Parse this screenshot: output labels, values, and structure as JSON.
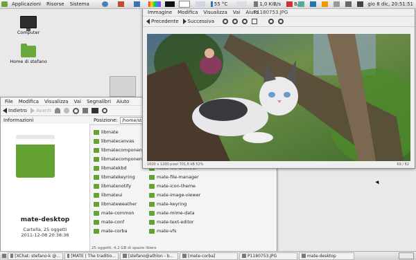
{
  "top_panel": {
    "menus": [
      "Applicazioni",
      "Risorse",
      "Sistema"
    ],
    "weather": "55 °C",
    "net_speed": "1,0 KiB/s",
    "net_speed2": "74 B/s",
    "clock": "gio  8 dic, 20:51:51"
  },
  "desktop": {
    "computer_label": "Computer",
    "home_label": "Home di stefano"
  },
  "caja": {
    "menu": [
      "File",
      "Modifica",
      "Visualizza",
      "Vai",
      "Segnalibri",
      "Aiuto"
    ],
    "back_label": "Indietro",
    "forward_label": "Avanti",
    "info_label": "Informazioni",
    "location_label": "Posizione:",
    "location_value": "/home/stef",
    "folder_name": "mate-desktop",
    "folder_meta1": "Cartella, 25 oggetti",
    "folder_meta2": "2011-12-08 20:38:36",
    "files_col1": [
      "libmate",
      "libmatecanvas",
      "libmatecomponent",
      "libmatecomponentui",
      "libmatekbd",
      "libmatekeyring",
      "libmatenotify",
      "libmateui",
      "libmateweather",
      "mate-common",
      "mate-conf",
      "mate-corba"
    ],
    "files_col2": [
      "mate-file-archiver",
      "mate-file-manager",
      "mate-icon-theme",
      "mate-image-viewer",
      "mate-keyring",
      "mate-mime-data",
      "mate-text-editor",
      "mate-vfs"
    ],
    "status": "25 oggetti, 4,2 GB di spazio libero"
  },
  "viewer": {
    "menu": [
      "Immagine",
      "Modifica",
      "Visualizza",
      "Vai",
      "Aiuto"
    ],
    "title": "P1180753.JPG",
    "prev_label": "Precedente",
    "next_label": "Successiva",
    "status_left": "1600 x 1200 pixel  701,8 kB   52%",
    "status_right": "69 / 82"
  },
  "taskbar": {
    "items": [
      "[XChat: stefano-k @...",
      "[MATE | The traditio...",
      "[stefano@athlon - b...",
      "[mate-corba]",
      "P1180753.JPG",
      "mate-desktop"
    ]
  }
}
